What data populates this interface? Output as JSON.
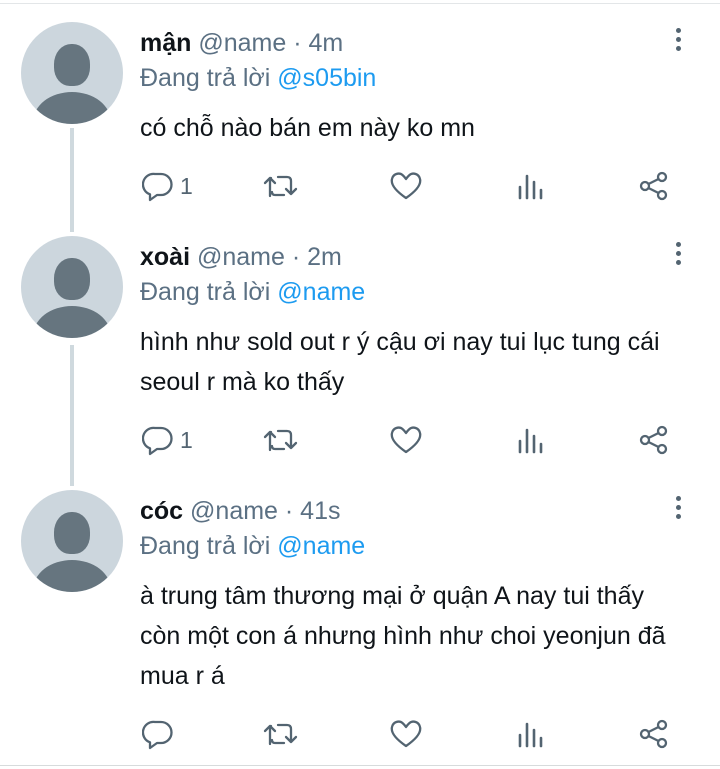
{
  "tweets": [
    {
      "display_name": "mận",
      "meta": "@name · 4m",
      "reply_prefix": "Đang trả lời ",
      "reply_handle": "@s05bin",
      "text": "có chỗ nào bán em này ko mn",
      "reply_count": "1",
      "retweet_count": "",
      "like_count": ""
    },
    {
      "display_name": "xoài",
      "meta": "@name · 2m",
      "reply_prefix": "Đang trả lời ",
      "reply_handle": "@name",
      "text": "hình như sold out r ý cậu ơi nay tui lục tung cái seoul r mà ko thấy",
      "reply_count": "1",
      "retweet_count": "",
      "like_count": ""
    },
    {
      "display_name": "cóc",
      "meta": "@name · 41s",
      "reply_prefix": "Đang trả lời ",
      "reply_handle": "@name",
      "text": "à trung tâm thương mại ở quận A nay tui thấy còn một con á nhưng hình như choi yeonjun đã mua r á",
      "reply_count": "",
      "retweet_count": "",
      "like_count": ""
    }
  ],
  "icons": {
    "reply": "reply-icon",
    "retweet": "retweet-icon",
    "like": "heart-icon",
    "views": "analytics-icon",
    "share": "share-icon",
    "more": "more-vertical-icon"
  },
  "colors": {
    "link": "#1d9bf0",
    "secondary_text": "#5b7083",
    "icon": "#536471",
    "avatar_bg": "#ccd6dd",
    "avatar_fg": "#66757f",
    "thread_line": "#cfd9de"
  }
}
